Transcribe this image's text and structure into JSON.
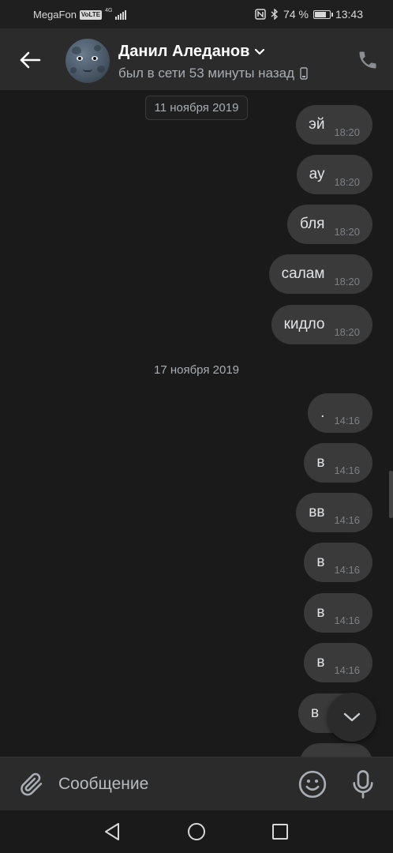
{
  "status_bar": {
    "carrier": "MegaFon",
    "volte": "VoLTE",
    "network": "4G",
    "battery": "74 %",
    "time": "13:43"
  },
  "header": {
    "contact_name": "Данил Аледанов",
    "contact_status": "был в сети 53 минуты назад"
  },
  "messages": {
    "dates": [
      "11 ноября 2019",
      "17 ноября 2019"
    ],
    "items": [
      {
        "text": "эй",
        "time": "18:20"
      },
      {
        "text": "ау",
        "time": "18:20"
      },
      {
        "text": "бля",
        "time": "18:20"
      },
      {
        "text": "салам",
        "time": "18:20"
      },
      {
        "text": "кидло",
        "time": "18:20"
      },
      {
        "text": ".",
        "time": "14:16"
      },
      {
        "text": "в",
        "time": "14:16"
      },
      {
        "text": "вв",
        "time": "14:16"
      },
      {
        "text": "в",
        "time": "14:16"
      },
      {
        "text": "в",
        "time": "14:16"
      },
      {
        "text": "в",
        "time": "14:16"
      },
      {
        "text": "в",
        "time": ""
      }
    ]
  },
  "composer": {
    "placeholder": "Сообщение"
  },
  "colors": {
    "background": "#1a1a1a",
    "header": "#2b2b2b",
    "bubble": "#3a3a3a",
    "text": "#e1e3e6",
    "muted": "#a8adb3"
  },
  "icons": {
    "back": "arrow-left-icon",
    "chevron": "chevron-down-icon",
    "device": "mobile-device-icon",
    "phone": "phone-icon",
    "attach": "paperclip-icon",
    "emoji": "smiley-icon",
    "mic": "microphone-icon",
    "scroll": "chevron-down-icon",
    "nav_back": "triangle-back-icon",
    "nav_home": "circle-home-icon",
    "nav_recent": "square-recent-icon"
  }
}
